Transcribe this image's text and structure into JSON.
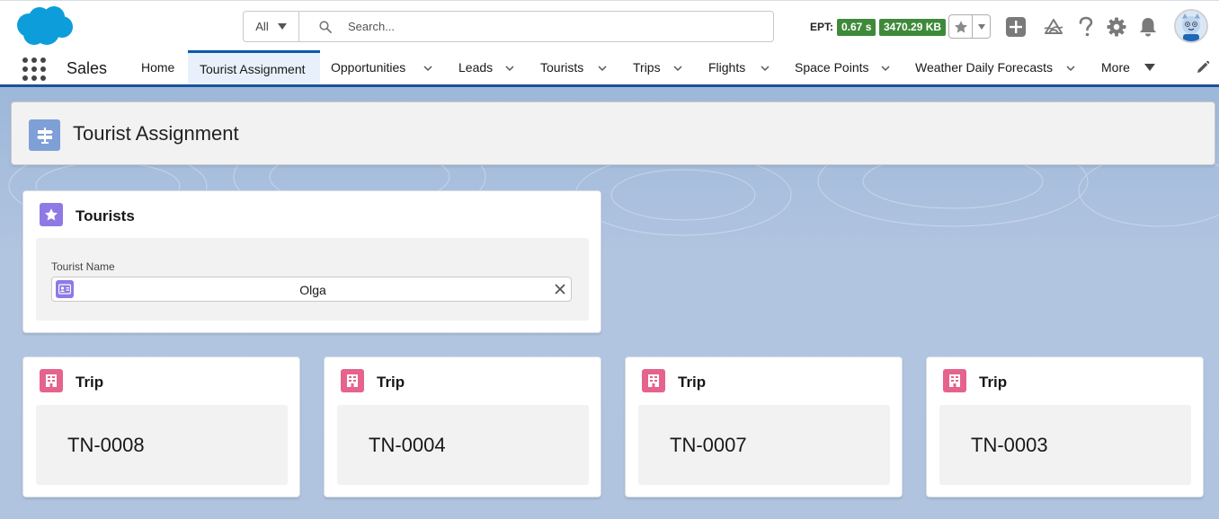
{
  "header": {
    "search": {
      "scope": "All",
      "placeholder": "Search..."
    },
    "ept_label": "EPT:",
    "ept_time": "0.67 s",
    "ept_size": "3470.29 KB"
  },
  "nav": {
    "app_name": "Sales",
    "items": [
      {
        "label": "Home"
      },
      {
        "label": "Tourist Assignment"
      },
      {
        "label": "Opportunities"
      },
      {
        "label": "Leads"
      },
      {
        "label": "Tourists"
      },
      {
        "label": "Trips"
      },
      {
        "label": "Flights"
      },
      {
        "label": "Space Points"
      },
      {
        "label": "Weather Daily Forecasts"
      },
      {
        "label": "More"
      }
    ]
  },
  "page": {
    "title": "Tourist Assignment"
  },
  "tourists_card": {
    "title": "Tourists",
    "field_label": "Tourist Name",
    "field_value": "Olga"
  },
  "trip_cards": [
    {
      "title": "Trip",
      "value": "TN-0008"
    },
    {
      "title": "Trip",
      "value": "TN-0004"
    },
    {
      "title": "Trip",
      "value": "TN-0007"
    },
    {
      "title": "Trip",
      "value": "TN-0003"
    }
  ],
  "colors": {
    "brand_blue": "#0b5cab",
    "tourist_icon": "#8f79e5",
    "trip_icon": "#e5638d",
    "ept_badge": "#3e8a3a"
  }
}
